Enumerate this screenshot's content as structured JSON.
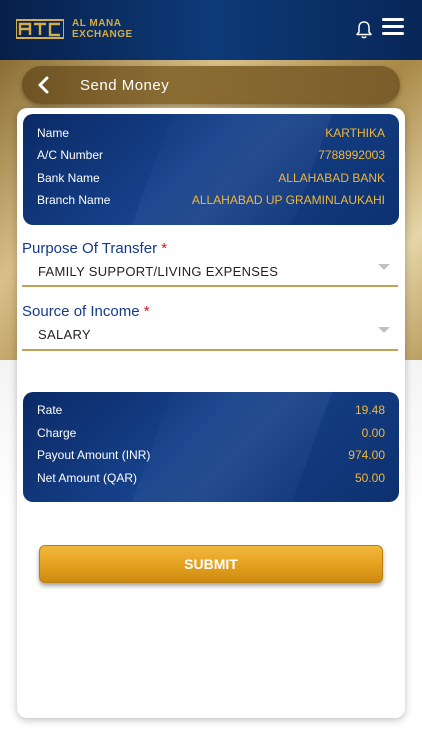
{
  "header": {
    "brand_line1": "AL MANA",
    "brand_line2": "EXCHANGE",
    "logo_icon": "alm-logo-mark",
    "bell_icon": "bell-icon",
    "menu_icon": "hamburger-icon"
  },
  "titlebar": {
    "title": "Send Money",
    "back_icon": "chevron-left-icon"
  },
  "beneficiary": {
    "rows": [
      {
        "label": "Name",
        "value": "KARTHIKA"
      },
      {
        "label": "A/C Number",
        "value": "7788992003"
      },
      {
        "label": "Bank Name",
        "value": "ALLAHABAD BANK"
      },
      {
        "label": "Branch Name",
        "value": "ALLAHABAD UP GRAMINLAUKAHI"
      }
    ]
  },
  "purpose": {
    "label": "Purpose Of Transfer",
    "required_mark": "*",
    "value": "FAMILY SUPPORT/LIVING EXPENSES"
  },
  "income": {
    "label": "Source of Income",
    "required_mark": "*",
    "value": "SALARY"
  },
  "summary": {
    "rows": [
      {
        "label": "Rate",
        "value": "19.48"
      },
      {
        "label": "Charge",
        "value": "0.00"
      },
      {
        "label": "Payout Amount (INR)",
        "value": "974.00"
      },
      {
        "label": "Net Amount (QAR)",
        "value": "50.00"
      }
    ]
  },
  "actions": {
    "submit_label": "SUBMIT"
  },
  "colors": {
    "navy": "#0b2a66",
    "gold": "#f0b73a",
    "label_blue": "#143a86",
    "required_red": "#d01818",
    "button_orange": "#e3a01e"
  }
}
